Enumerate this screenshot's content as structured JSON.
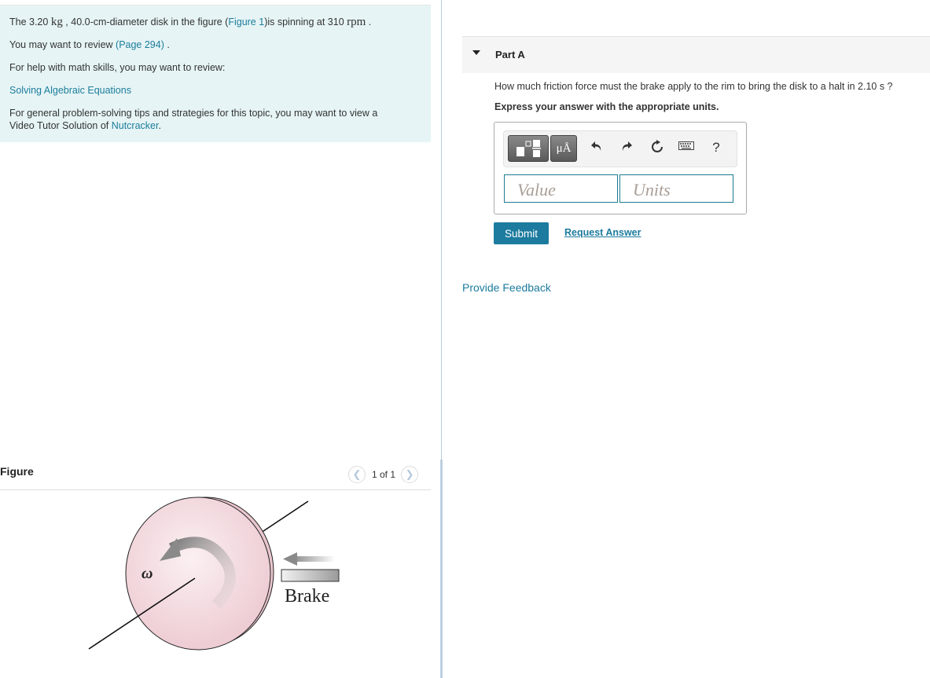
{
  "intro": {
    "line1": {
      "prefix": "The 3.20 ",
      "mass_unit": "kg",
      "middle": " , 40.0-cm-diameter disk in the figure (",
      "figure_link": "Figure 1",
      "suffix": ")is spinning at 310 ",
      "speed_unit": "rpm",
      "end": " ."
    },
    "line2": {
      "prefix": "You may want to review ",
      "page_link": "(Page 294)",
      "suffix": " ."
    },
    "line3": "For help with math skills, you may want to review:",
    "math_link": "Solving Algebraic Equations",
    "line5": {
      "text1": "For general problem-solving tips and strategies for this topic, you may want to view a",
      "text2": "Video Tutor Solution of ",
      "link": "Nutcracker",
      "end": "."
    }
  },
  "figure": {
    "title": "Figure",
    "pager": "1 of 1",
    "prev_icon": "chevron-left",
    "next_icon": "chevron-right",
    "omega_label": "ω",
    "brake_label": "Brake"
  },
  "partA": {
    "title": "Part A",
    "question": "How much friction force must the brake apply to the rim to bring the disk to a halt in 2.10 s ?",
    "instruction": "Express your answer with the appropriate units.",
    "toolbar": {
      "templates_icon": "fraction-template-icon",
      "units_label": "μÅ",
      "undo_icon": "undo",
      "redo_icon": "redo",
      "reset_icon": "reset",
      "keyboard_icon": "keyboard",
      "help_label": "?"
    },
    "value_placeholder": "Value",
    "units_placeholder": "Units",
    "submit_label": "Submit",
    "request_label": "Request Answer"
  },
  "feedback_label": "Provide Feedback",
  "colors": {
    "link": "#1c7b9e",
    "intro_bg": "#e6f4f5",
    "submit_bg": "#1c7b9e",
    "disk_fill": "#f3dfe3"
  }
}
